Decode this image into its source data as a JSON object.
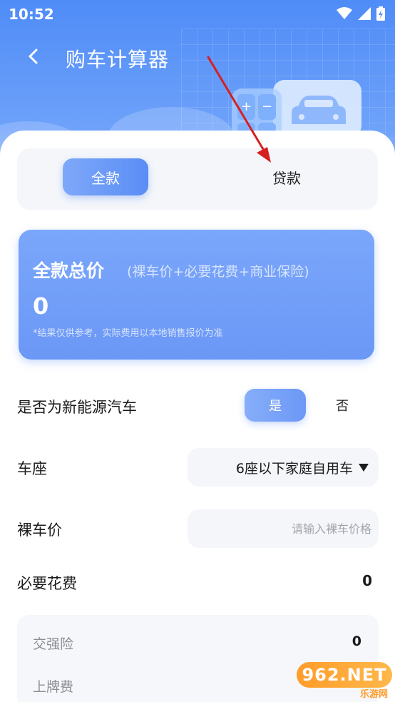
{
  "status_bar": {
    "time": "10:52"
  },
  "header": {
    "title": "购车计算器",
    "back_icon": "chevron-left-icon"
  },
  "illustration": {
    "calc_keys": [
      "+",
      "−",
      "",
      ""
    ]
  },
  "tabs": [
    {
      "label": "全款",
      "active": true
    },
    {
      "label": "贷款",
      "active": false
    }
  ],
  "total_card": {
    "title": "全款总价",
    "subtitle": "(裸车价+必要花费+商业保险)",
    "value": "0",
    "note": "*结果仅供参考，实际费用以本地销售报价为准"
  },
  "form": {
    "new_energy": {
      "label": "是否为新能源汽车",
      "yes": "是",
      "no": "否",
      "selected": "是"
    },
    "seats": {
      "label": "车座",
      "value": "6座以下家庭自用车"
    },
    "bare_price": {
      "label": "裸车价",
      "placeholder": "请输入裸车价格"
    },
    "required_fees": {
      "label": "必要花费",
      "value": "0"
    }
  },
  "fee_details": [
    {
      "label": "交强险",
      "value": "0"
    },
    {
      "label": "上牌费",
      "value": ""
    }
  ],
  "watermark": {
    "badge": "962.NET",
    "sub": "乐游网"
  },
  "colors": {
    "primary": "#5a8df5",
    "header_top": "#4f8cf7",
    "annotation": "#d62020",
    "watermark": "#ff9c2a"
  }
}
